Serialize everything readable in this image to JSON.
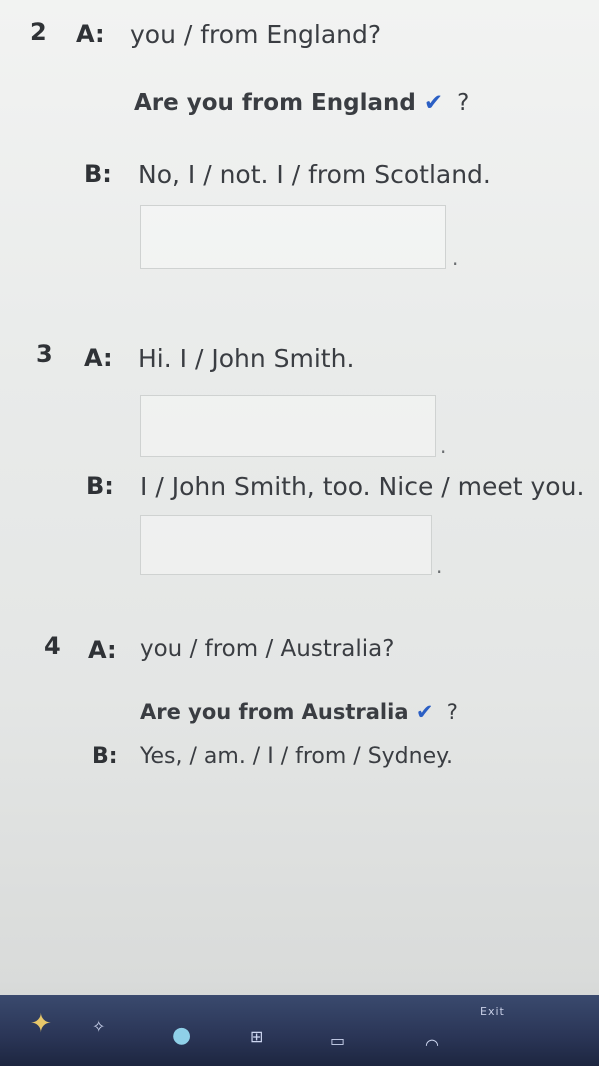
{
  "exercise": {
    "q2": {
      "number": "2",
      "a_label": "A:",
      "a_prompt": "you / from England?",
      "answer_text": "Are you from England",
      "check": "✔",
      "qmark": "?",
      "b_label": "B:",
      "b_prompt": "No, I / not. I / from Scotland."
    },
    "q3": {
      "number": "3",
      "a_label": "A:",
      "a_prompt": "Hi. I / John Smith.",
      "b_label": "B:",
      "b_prompt": "I / John Smith, too. Nice / meet you."
    },
    "q4": {
      "number": "4",
      "a_label": "A:",
      "a_prompt": "you / from / Australia?",
      "answer_text": "Are you from Australia",
      "check": "✔",
      "qmark": "?",
      "b_label": "B:",
      "b_prompt": "Yes, / am. / I / from / Sydney."
    },
    "period": "."
  },
  "taskbar": {
    "exit_label": "Exit"
  },
  "colors": {
    "check": "#2b5fc4",
    "text": "#3a3d42",
    "taskbar": "#2a3556"
  }
}
